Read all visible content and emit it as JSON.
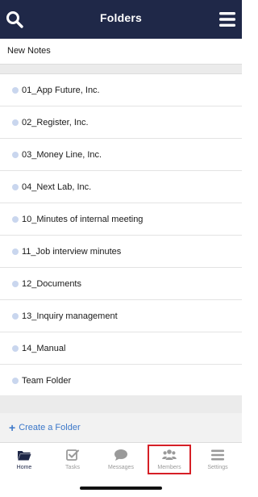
{
  "header": {
    "title": "Folders",
    "search_icon": "search-icon",
    "menu_icon": "hamburger-menu-icon"
  },
  "new_notes": {
    "label": "New Notes"
  },
  "folders": [
    {
      "label": "01_App Future, Inc."
    },
    {
      "label": "02_Register, Inc."
    },
    {
      "label": "03_Money Line, Inc."
    },
    {
      "label": "04_Next Lab, Inc."
    },
    {
      "label": "10_Minutes of internal meeting"
    },
    {
      "label": "11_Job interview minutes"
    },
    {
      "label": "12_Documents"
    },
    {
      "label": "13_Inquiry management"
    },
    {
      "label": "14_Manual"
    },
    {
      "label": "Team Folder"
    }
  ],
  "create_folder": {
    "plus": "+",
    "label": "Create a Folder"
  },
  "tabs": [
    {
      "label": "Home",
      "icon": "folder-icon",
      "active": true
    },
    {
      "label": "Tasks",
      "icon": "checkbox-icon",
      "active": false
    },
    {
      "label": "Messages",
      "icon": "chat-bubble-icon",
      "active": false
    },
    {
      "label": "Members",
      "icon": "members-icon",
      "active": false,
      "highlighted": true
    },
    {
      "label": "Settings",
      "icon": "settings-list-icon",
      "active": false
    }
  ],
  "colors": {
    "header_bg": "#1f2848",
    "accent_blue": "#3b77c9",
    "dot": "#c9d6ee",
    "highlight_red": "#d61f26"
  }
}
